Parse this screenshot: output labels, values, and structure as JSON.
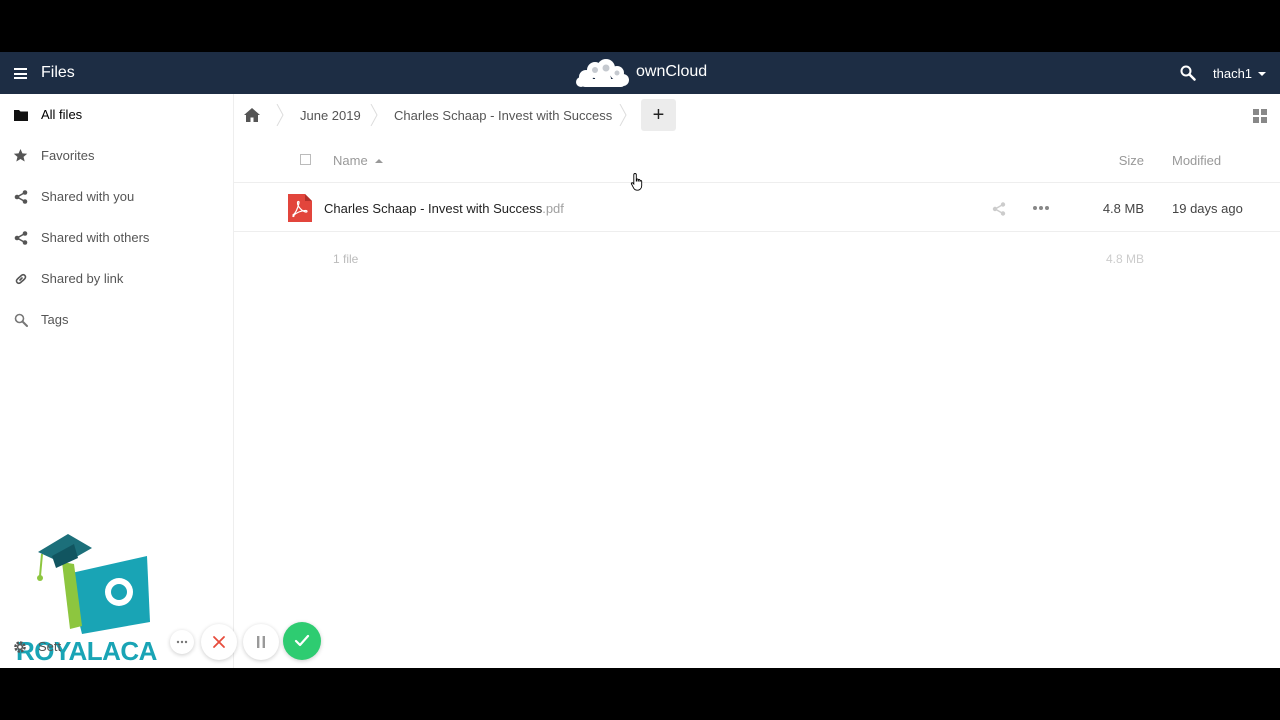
{
  "header": {
    "app_name": "Files",
    "brand": "ownCloud",
    "user": "thach1"
  },
  "sidebar": {
    "items": [
      {
        "label": "All files",
        "icon": "folder-icon",
        "active": true
      },
      {
        "label": "Favorites",
        "icon": "star-icon"
      },
      {
        "label": "Shared with you",
        "icon": "share-icon"
      },
      {
        "label": "Shared with others",
        "icon": "share-icon"
      },
      {
        "label": "Shared by link",
        "icon": "link-icon"
      },
      {
        "label": "Tags",
        "icon": "tag-search-icon"
      }
    ],
    "settings_label": "Sett"
  },
  "breadcrumb": {
    "items": [
      "June 2019",
      "Charles Schaap - Invest with Success"
    ],
    "new_label": "+"
  },
  "table": {
    "headers": {
      "name": "Name",
      "size": "Size",
      "modified": "Modified"
    },
    "rows": [
      {
        "name": "Charles Schaap - Invest with Success",
        "ext": ".pdf",
        "size": "4.8 MB",
        "modified": "19 days ago",
        "icon": "pdf-icon"
      }
    ],
    "summary": {
      "count": "1 file",
      "size": "4.8 MB"
    }
  },
  "watermark": {
    "text": "ROYALACA"
  },
  "colors": {
    "header_bg": "#1d2d44",
    "pdf_red": "#e2453c",
    "confirm_green": "#2ecc71",
    "cancel_red": "#e74c3c"
  }
}
